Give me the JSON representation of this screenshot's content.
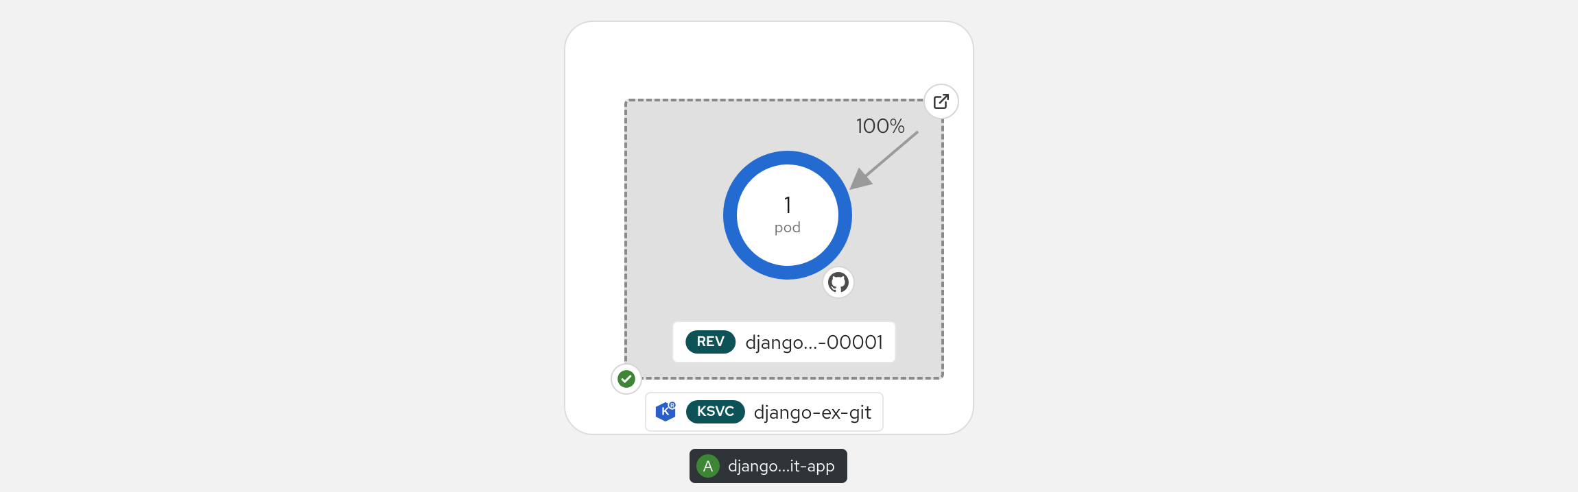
{
  "service": {
    "traffic_percent": "100%",
    "pod": {
      "count": "1",
      "label": "pod"
    },
    "revision": {
      "tag": "REV",
      "name": "django...-00001"
    },
    "ksvc": {
      "tag": "KSVC",
      "name": "django-ex-git"
    }
  },
  "application": {
    "letter": "A",
    "name": "django...it-app"
  },
  "icons": {
    "route": "external-link-icon",
    "source": "github-icon",
    "status": "check-icon",
    "knative": "knative-icon"
  },
  "colors": {
    "donut_ring": "#236ad1",
    "tag_teal": "#0d5257",
    "status_green": "#3d8635",
    "app_pill_bg": "#2e3438"
  }
}
